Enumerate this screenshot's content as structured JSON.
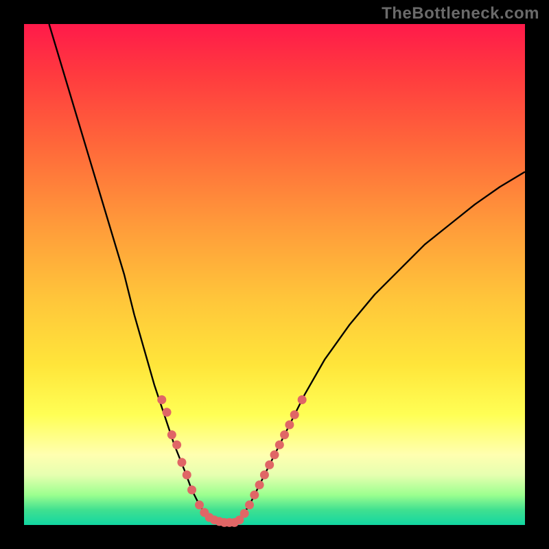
{
  "watermark": "TheBottleneck.com",
  "chart_data": {
    "type": "line",
    "title": "",
    "xlabel": "",
    "ylabel": "",
    "xlim": [
      0,
      100
    ],
    "ylim": [
      0,
      100
    ],
    "grid": false,
    "legend": false,
    "series": [
      {
        "name": "left-curve",
        "color": "#000000",
        "x": [
          5,
          8,
          11,
          14,
          17,
          20,
          22,
          24,
          26,
          28,
          30,
          32,
          33.5,
          35,
          36,
          37,
          38
        ],
        "y": [
          100,
          90,
          80,
          70,
          60,
          50,
          42,
          35,
          28,
          22,
          16,
          11,
          7,
          4,
          2.5,
          1.5,
          1
        ]
      },
      {
        "name": "valley-flat",
        "color": "#000000",
        "x": [
          38,
          40,
          42,
          43
        ],
        "y": [
          1,
          0.5,
          0.5,
          1
        ]
      },
      {
        "name": "right-curve",
        "color": "#000000",
        "x": [
          43,
          45,
          48,
          52,
          56,
          60,
          65,
          70,
          75,
          80,
          85,
          90,
          95,
          100
        ],
        "y": [
          1,
          4,
          10,
          18,
          26,
          33,
          40,
          46,
          51,
          56,
          60,
          64,
          67.5,
          70.5
        ]
      }
    ],
    "markers": [
      {
        "name": "left-dots",
        "color": "#e06666",
        "points": [
          {
            "x": 27.5,
            "y": 25
          },
          {
            "x": 28.5,
            "y": 22.5
          },
          {
            "x": 29.5,
            "y": 18
          },
          {
            "x": 30.5,
            "y": 16
          },
          {
            "x": 31.5,
            "y": 12.5
          },
          {
            "x": 32.5,
            "y": 10
          },
          {
            "x": 33.5,
            "y": 7
          },
          {
            "x": 35,
            "y": 4
          },
          {
            "x": 36,
            "y": 2.5
          },
          {
            "x": 37,
            "y": 1.5
          },
          {
            "x": 38,
            "y": 1
          },
          {
            "x": 39,
            "y": 0.7
          },
          {
            "x": 40,
            "y": 0.5
          },
          {
            "x": 41,
            "y": 0.5
          },
          {
            "x": 42,
            "y": 0.5
          },
          {
            "x": 43,
            "y": 1
          }
        ]
      },
      {
        "name": "right-dots",
        "color": "#e06666",
        "points": [
          {
            "x": 44,
            "y": 2.3
          },
          {
            "x": 45,
            "y": 4
          },
          {
            "x": 46,
            "y": 6
          },
          {
            "x": 47,
            "y": 8
          },
          {
            "x": 48,
            "y": 10
          },
          {
            "x": 49,
            "y": 12
          },
          {
            "x": 50,
            "y": 14
          },
          {
            "x": 51,
            "y": 16
          },
          {
            "x": 52,
            "y": 18
          },
          {
            "x": 53,
            "y": 20
          },
          {
            "x": 54,
            "y": 22
          },
          {
            "x": 55.5,
            "y": 25
          }
        ]
      }
    ]
  }
}
